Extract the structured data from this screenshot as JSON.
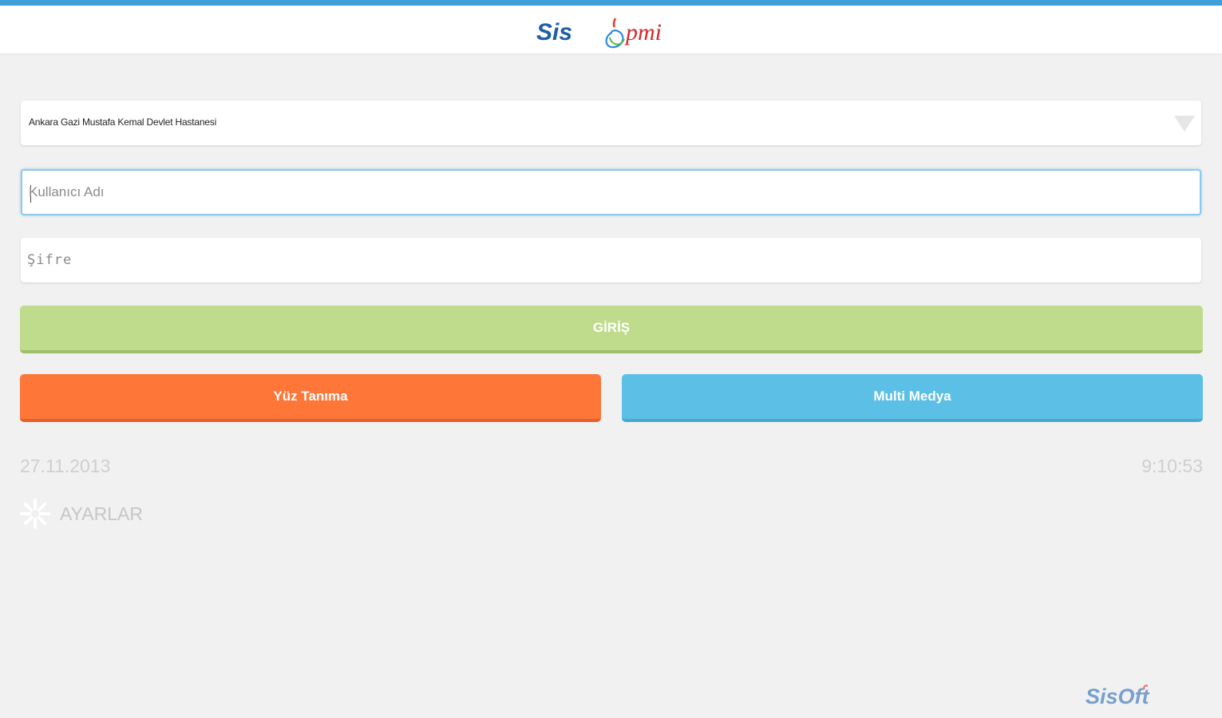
{
  "header": {
    "logo_text_left": "Sis",
    "logo_text_right": "pmi",
    "brand_color": "#3f9fd8"
  },
  "form": {
    "hospital_selected": "Ankara Gazi Mustafa Kemal Devlet Hastanesi",
    "username_placeholder": "Kullanıcı Adı",
    "password_placeholder": "Şifre"
  },
  "buttons": {
    "login_label": "GİRİŞ",
    "face_label": "Yüz Tanıma",
    "media_label": "Multi Medya"
  },
  "colors": {
    "login": "#bfdb8c",
    "face": "#ff7639",
    "media": "#5cc0e6"
  },
  "status": {
    "date": "27.11.2013",
    "time": "9:10:53"
  },
  "settings": {
    "label": "AYARLAR",
    "icon": "settings-icon"
  },
  "footer": {
    "logo_text": "SisOft"
  }
}
